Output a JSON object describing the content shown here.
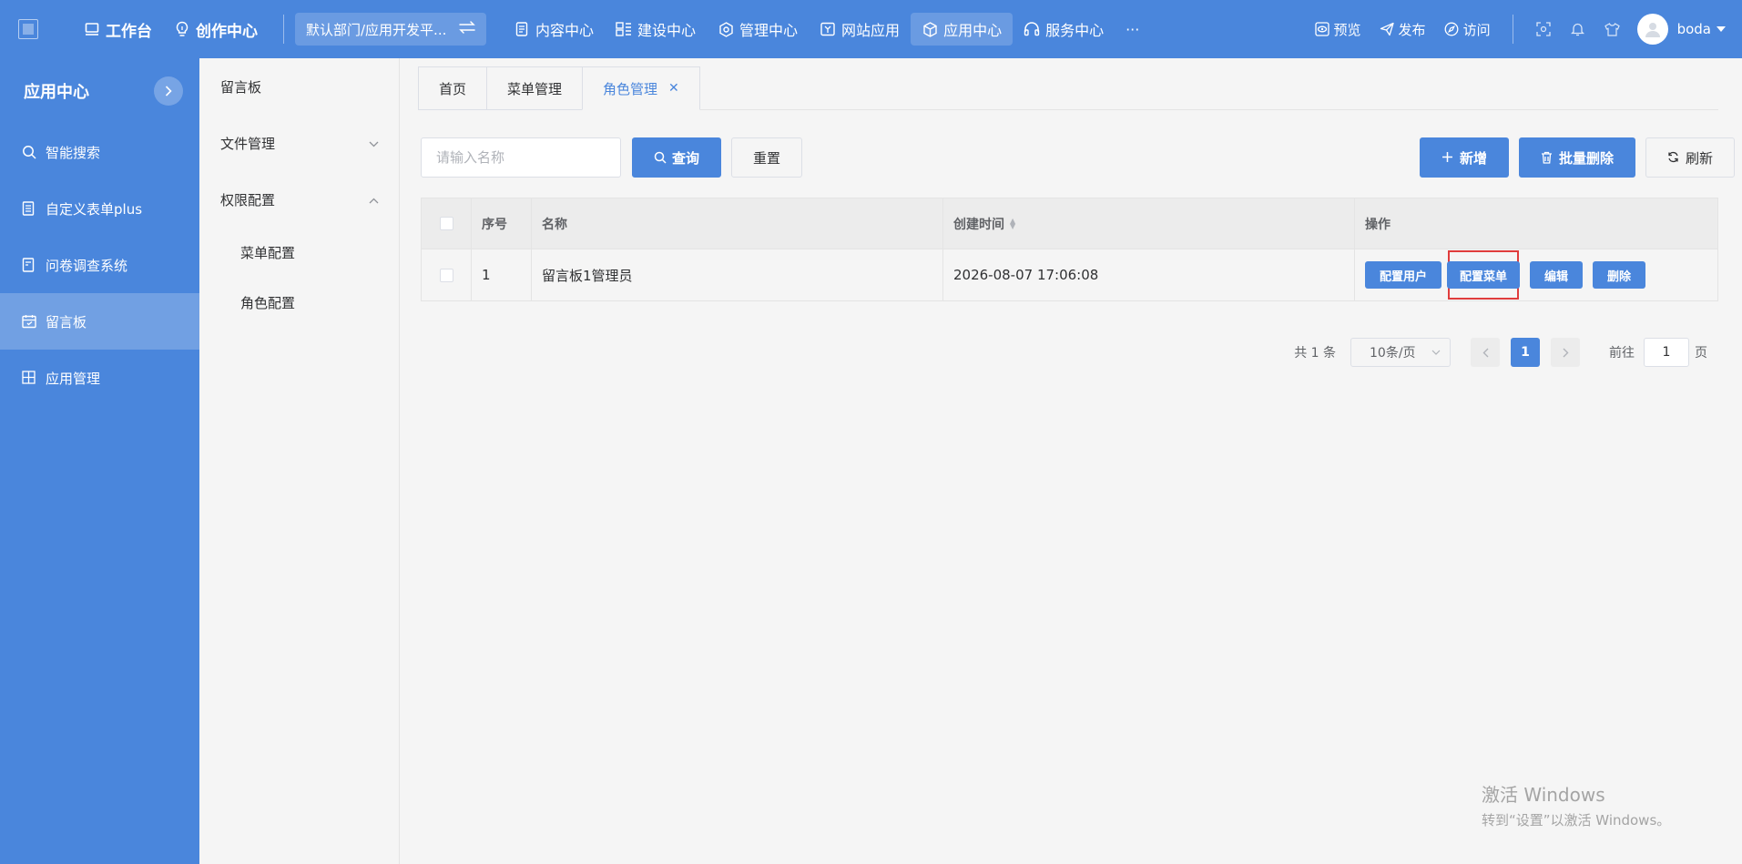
{
  "topbar": {
    "workbench": "工作台",
    "create_center": "创作中心",
    "department": "默认部门/应用开发平...",
    "nav": [
      {
        "label": "内容中心"
      },
      {
        "label": "建设中心"
      },
      {
        "label": "管理中心"
      },
      {
        "label": "网站应用"
      },
      {
        "label": "应用中心"
      },
      {
        "label": "服务中心"
      }
    ],
    "more": "···",
    "preview": "预览",
    "publish": "发布",
    "visit": "访问",
    "username": "boda"
  },
  "sidebar": {
    "title": "应用中心",
    "items": [
      {
        "label": "智能搜索",
        "icon": "search-icon"
      },
      {
        "label": "自定义表单plus",
        "icon": "form-icon"
      },
      {
        "label": "问卷调查系统",
        "icon": "survey-icon"
      },
      {
        "label": "留言板",
        "icon": "message-board-icon"
      },
      {
        "label": "应用管理",
        "icon": "grid-icon"
      }
    ]
  },
  "subnav": {
    "items": [
      {
        "label": "留言板"
      },
      {
        "label": "文件管理"
      },
      {
        "label": "权限配置"
      }
    ],
    "subitems": [
      {
        "label": "菜单配置"
      },
      {
        "label": "角色配置"
      }
    ]
  },
  "tabs": [
    {
      "label": "首页"
    },
    {
      "label": "菜单管理"
    },
    {
      "label": "角色管理"
    }
  ],
  "toolbar": {
    "search_placeholder": "请输入名称",
    "query": "查询",
    "reset": "重置",
    "add": "新增",
    "batch_delete": "批量删除",
    "refresh": "刷新"
  },
  "table": {
    "columns": [
      "序号",
      "名称",
      "创建时间",
      "操作"
    ],
    "rows": [
      {
        "index": "1",
        "name": "留言板1管理员",
        "created": "2026-08-07 17:06:08"
      }
    ],
    "actions": {
      "config_users": "配置用户",
      "config_menu": "配置菜单",
      "edit": "编辑",
      "delete": "删除"
    }
  },
  "pagination": {
    "total": "共 1 条",
    "page_size": "10条/页",
    "current": "1",
    "goto": "前往",
    "goto_value": "1",
    "page_unit": "页"
  },
  "watermark": {
    "line1": "激活 Windows",
    "line2": "转到“设置”以激活 Windows。"
  },
  "colors": {
    "primary": "#4a86dc",
    "highlight_border": "#e03c3c"
  }
}
